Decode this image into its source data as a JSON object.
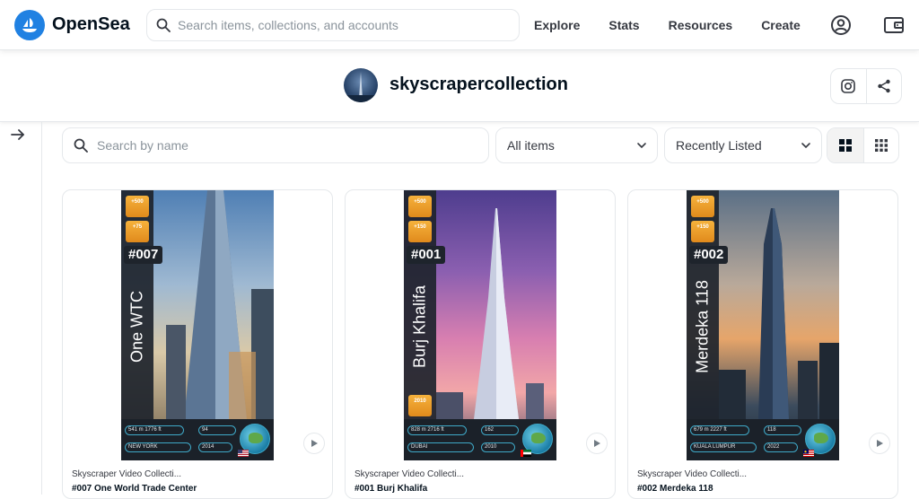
{
  "nav": {
    "brand": "OpenSea",
    "search_placeholder": "Search items, collections, and accounts",
    "links": [
      "Explore",
      "Stats",
      "Resources",
      "Create"
    ]
  },
  "collection": {
    "name": "skyscrapercollection"
  },
  "filters": {
    "search_placeholder": "Search by name",
    "items_filter": "All items",
    "sort": "Recently Listed"
  },
  "colors": {
    "brand": "#2081e2",
    "badge": "#f0a02c",
    "stat_outline": "#3fa9c8"
  },
  "cards": [
    {
      "collection": "Skyscraper Video Collecti...",
      "title": "#007 One World Trade Center",
      "number": "#007",
      "vertical_name": "One WTC",
      "badges": [
        "+500",
        "+75"
      ],
      "height": "541 m 1776 ft",
      "floors": "94",
      "city": "NEW YORK",
      "year": "2014",
      "flag": "us"
    },
    {
      "collection": "Skyscraper Video Collecti...",
      "title": "#001 Burj Khalifa",
      "number": "#001",
      "vertical_name": "Burj Khalifa",
      "badges": [
        "+500",
        "+150",
        "2010"
      ],
      "height": "828 m 2716 ft",
      "floors": "162",
      "city": "DUBAI",
      "year": "2010",
      "flag": "ae"
    },
    {
      "collection": "Skyscraper Video Collecti...",
      "title": "#002 Merdeka 118",
      "number": "#002",
      "vertical_name": "Merdeka 118",
      "badges": [
        "+500",
        "+150"
      ],
      "height": "679 m 2227 ft",
      "floors": "118",
      "city": "KUALA LUMPUR",
      "year": "2022",
      "flag": "my"
    }
  ]
}
